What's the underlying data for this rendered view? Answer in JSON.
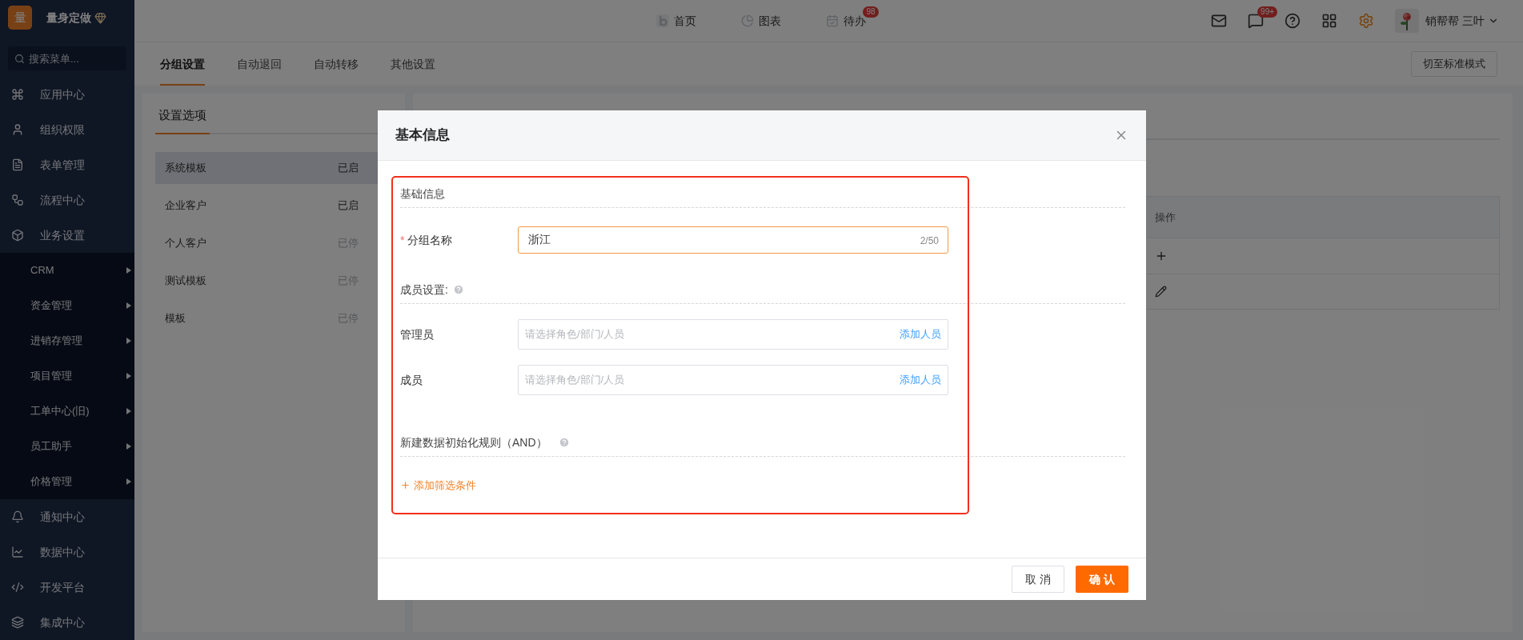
{
  "sidebar": {
    "logo": "量",
    "brand": "量身定做",
    "search": {
      "placeholder": "搜索菜单..."
    },
    "items": [
      {
        "label": "应用中心"
      },
      {
        "label": "组织权限"
      },
      {
        "label": "表单管理"
      },
      {
        "label": "流程中心"
      },
      {
        "label": "业务设置",
        "expanded": true,
        "children": [
          {
            "label": "CRM",
            "expanded": false
          },
          {
            "label": "资金管理",
            "expanded": false
          },
          {
            "label": "进销存管理",
            "expanded": false
          },
          {
            "label": "项目管理",
            "expanded": false
          },
          {
            "label": "工单中心(旧)",
            "expanded": false
          },
          {
            "label": "员工助手",
            "expanded": false
          },
          {
            "label": "价格管理",
            "expanded": false
          }
        ]
      },
      {
        "label": "通知中心"
      },
      {
        "label": "数据中心"
      },
      {
        "label": "开发平台"
      },
      {
        "label": "集成中心"
      }
    ]
  },
  "top_nav": [
    {
      "label": "首页"
    },
    {
      "label": "图表"
    },
    {
      "label": "待办",
      "badge": "98"
    }
  ],
  "top_right": {
    "message_badge": "99+",
    "user_name": "销帮帮 三叶"
  },
  "tabs": [
    {
      "label": "分组设置",
      "selected": true
    },
    {
      "label": "自动退回",
      "selected": false
    },
    {
      "label": "自动转移",
      "selected": false
    },
    {
      "label": "其他设置",
      "selected": false
    }
  ],
  "mode_button": "切至标准模式",
  "settings_panel": {
    "title": "设置选项",
    "items": [
      {
        "name": "系统模板",
        "status": "已启",
        "enabled": true,
        "selected": true
      },
      {
        "name": "企业客户",
        "status": "已启",
        "enabled": true,
        "selected": false
      },
      {
        "name": "个人客户",
        "status": "已停",
        "enabled": false,
        "selected": false
      },
      {
        "name": "测试模板",
        "status": "已停",
        "enabled": false,
        "selected": false
      },
      {
        "name": "模板",
        "status": "已停",
        "enabled": false,
        "selected": false
      }
    ]
  },
  "table": {
    "columns": [
      "操作"
    ],
    "rows": [
      {
        "kind": "add"
      },
      {
        "kind": "edit"
      }
    ]
  },
  "modal": {
    "title": "基本信息",
    "basic_section": "基础信息",
    "group_name": {
      "required_mark": "*",
      "label": "分组名称",
      "value": "浙江",
      "counter": "2/50"
    },
    "member_section": "成员设置:",
    "member_fields": [
      {
        "label": "管理员",
        "placeholder": "请选择角色/部门/人员",
        "action": "添加人员"
      },
      {
        "label": "成员",
        "placeholder": "请选择角色/部门/人员",
        "action": "添加人员"
      }
    ],
    "rule_section": "新建数据初始化规则（AND）",
    "add_filter": "添加筛选条件",
    "buttons": [
      {
        "label": "取 消",
        "kind": "secondary"
      },
      {
        "label": "确 认",
        "kind": "primary"
      }
    ]
  }
}
